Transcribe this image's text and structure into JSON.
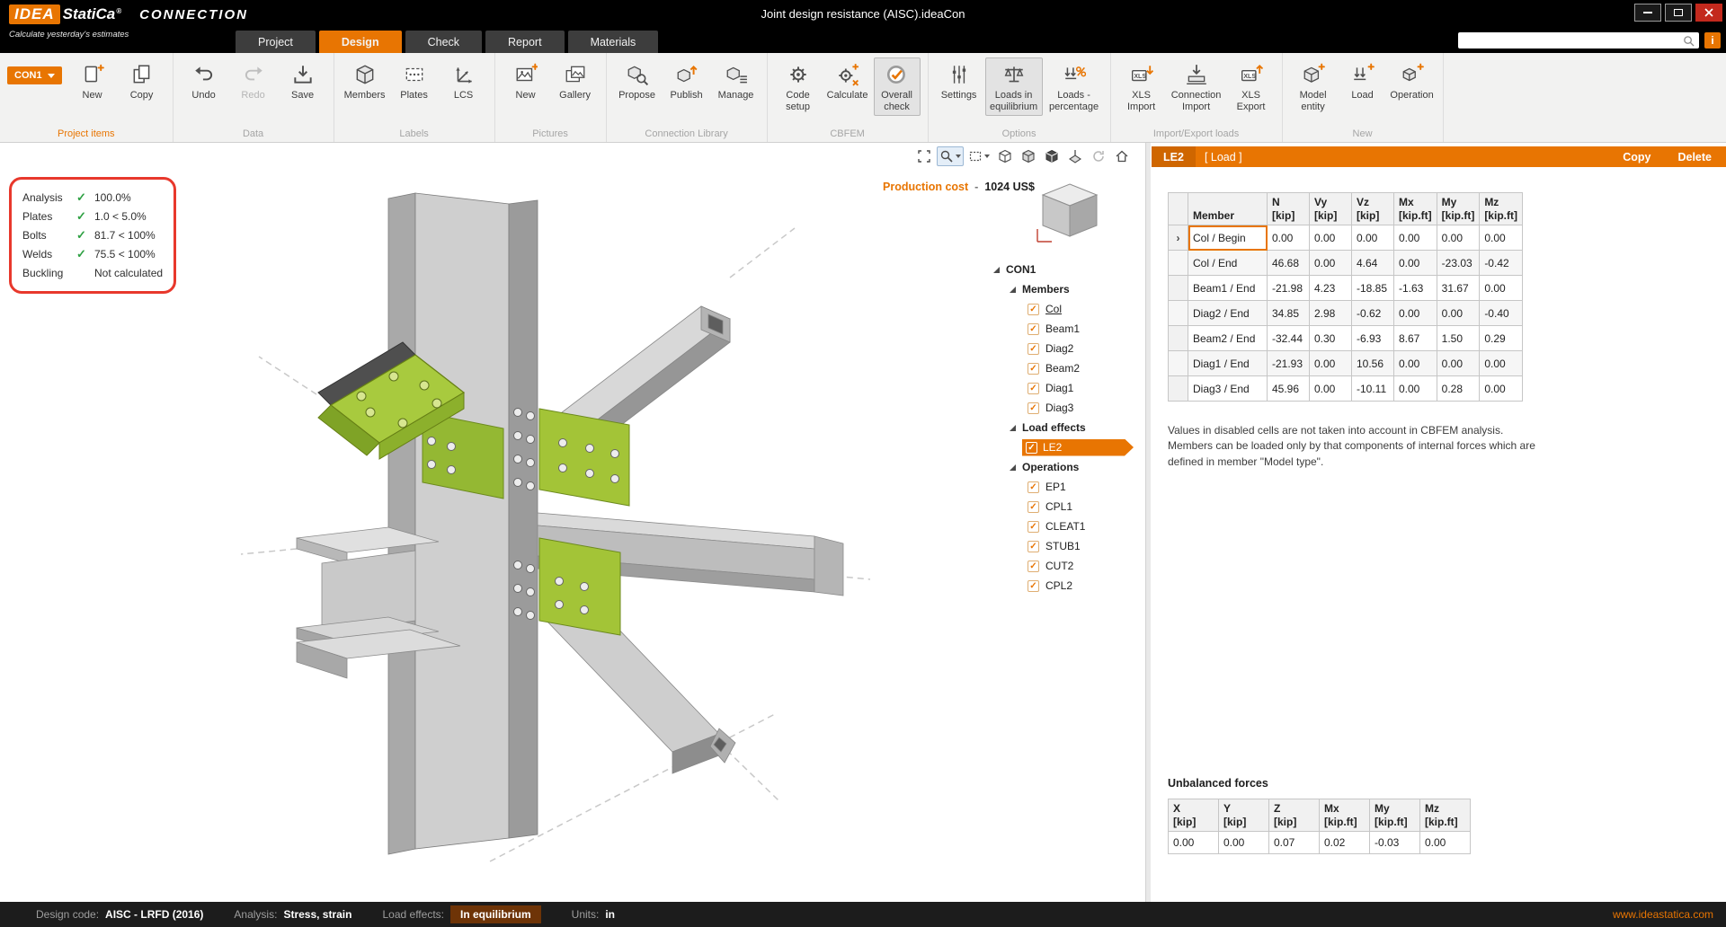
{
  "icons": {
    "check": "✓",
    "info": "i",
    "selector": "›",
    "xls": "XLS",
    "reg": "®"
  },
  "titlebar": {
    "logo": {
      "idea": "IDEA",
      "statica": "StatiCa",
      "product": "CONNECTION",
      "tagline": "Calculate yesterday's estimates"
    },
    "window_title": "Joint design resistance (AISC).ideaCon"
  },
  "tabs": {
    "items": [
      {
        "label": "Project"
      },
      {
        "label": "Design"
      },
      {
        "label": "Check"
      },
      {
        "label": "Report"
      },
      {
        "label": "Materials"
      }
    ]
  },
  "ribbon": {
    "project_items": {
      "label": "Project items",
      "con1": "CON1",
      "new": "New",
      "copy": "Copy"
    },
    "data": {
      "label": "Data",
      "undo": "Undo",
      "redo": "Redo",
      "save": "Save"
    },
    "labels": {
      "label": "Labels",
      "members": "Members",
      "plates": "Plates",
      "lcs": "LCS"
    },
    "pictures": {
      "label": "Pictures",
      "new": "New",
      "gallery": "Gallery"
    },
    "library": {
      "label": "Connection Library",
      "propose": "Propose",
      "publish": "Publish",
      "manage": "Manage"
    },
    "cbfem": {
      "label": "CBFEM",
      "code_setup": "Code setup",
      "calculate": "Calculate",
      "overall_check": "Overall check"
    },
    "options": {
      "label": "Options",
      "settings": "Settings",
      "loads_eq": "Loads in equilibrium",
      "loads_pct": "Loads - percentage"
    },
    "import_export": {
      "label": "Import/Export loads",
      "xls_import": "XLS Import",
      "conn_import": "Connection Import",
      "xls_export": "XLS Export"
    },
    "new_group": {
      "label": "New",
      "model_entity": "Model entity",
      "load": "Load",
      "operation": "Operation"
    }
  },
  "viewport": {
    "summary": {
      "rows": [
        {
          "label": "Analysis",
          "check": "✓",
          "value": "100.0%"
        },
        {
          "label": "Plates",
          "check": "✓",
          "value": "1.0 < 5.0%"
        },
        {
          "label": "Bolts",
          "check": "✓",
          "value": "81.7 < 100%"
        },
        {
          "label": "Welds",
          "check": "✓",
          "value": "75.5 < 100%"
        },
        {
          "label": "Buckling",
          "check": "",
          "value": "Not calculated"
        }
      ]
    },
    "production_cost": {
      "label": "Production cost",
      "sep": "-",
      "value": "1024 US$"
    }
  },
  "tree": {
    "root": "CON1",
    "members_label": "Members",
    "members": [
      "Col",
      "Beam1",
      "Diag2",
      "Beam2",
      "Diag1",
      "Diag3"
    ],
    "load_effects_label": "Load effects",
    "load_effects": [
      "LE2"
    ],
    "operations_label": "Operations",
    "operations": [
      "EP1",
      "CPL1",
      "CLEAT1",
      "STUB1",
      "CUT2",
      "CPL2"
    ]
  },
  "panel": {
    "title": "LE2",
    "subtitle": "[ Load ]",
    "copy": "Copy",
    "delete": "Delete",
    "load_table": {
      "headers": [
        {
          "name": "Member",
          "unit": ""
        },
        {
          "name": "N",
          "unit": "[kip]"
        },
        {
          "name": "Vy",
          "unit": "[kip]"
        },
        {
          "name": "Vz",
          "unit": "[kip]"
        },
        {
          "name": "Mx",
          "unit": "[kip.ft]"
        },
        {
          "name": "My",
          "unit": "[kip.ft]"
        },
        {
          "name": "Mz",
          "unit": "[kip.ft]"
        }
      ],
      "rows": [
        {
          "member": "Col / Begin",
          "values": [
            "0.00",
            "0.00",
            "0.00",
            "0.00",
            "0.00",
            "0.00"
          ]
        },
        {
          "member": "Col / End",
          "values": [
            "46.68",
            "0.00",
            "4.64",
            "0.00",
            "-23.03",
            "-0.42"
          ]
        },
        {
          "member": "Beam1 / End",
          "values": [
            "-21.98",
            "4.23",
            "-18.85",
            "-1.63",
            "31.67",
            "0.00"
          ]
        },
        {
          "member": "Diag2 / End",
          "values": [
            "34.85",
            "2.98",
            "-0.62",
            "0.00",
            "0.00",
            "-0.40"
          ]
        },
        {
          "member": "Beam2 / End",
          "values": [
            "-32.44",
            "0.30",
            "-6.93",
            "8.67",
            "1.50",
            "0.29"
          ]
        },
        {
          "member": "Diag1 / End",
          "values": [
            "-21.93",
            "0.00",
            "10.56",
            "0.00",
            "0.00",
            "0.00"
          ]
        },
        {
          "member": "Diag3 / End",
          "values": [
            "45.96",
            "0.00",
            "-10.11",
            "0.00",
            "0.28",
            "0.00"
          ]
        }
      ]
    },
    "note": "Values in disabled cells are not taken into account in CBFEM analysis. Members can be loaded only by that components of internal forces which are defined in member \"Model type\".",
    "unbalanced": {
      "title": "Unbalanced forces",
      "headers": [
        {
          "name": "X",
          "unit": "[kip]"
        },
        {
          "name": "Y",
          "unit": "[kip]"
        },
        {
          "name": "Z",
          "unit": "[kip]"
        },
        {
          "name": "Mx",
          "unit": "[kip.ft]"
        },
        {
          "name": "My",
          "unit": "[kip.ft]"
        },
        {
          "name": "Mz",
          "unit": "[kip.ft]"
        }
      ],
      "values": [
        "0.00",
        "0.00",
        "0.07",
        "0.02",
        "-0.03",
        "0.00"
      ]
    }
  },
  "statusbar": {
    "design_code_label": "Design code:",
    "design_code": "AISC - LRFD (2016)",
    "analysis_label": "Analysis:",
    "analysis": "Stress, strain",
    "load_effects_label": "Load effects:",
    "load_effects": "In equilibrium",
    "units_label": "Units:",
    "units": "in",
    "website": "www.ideastatica.com"
  },
  "colors": {
    "accent": "#e87502",
    "ok_green": "#2ea043",
    "model_green": "#a3c437",
    "alert_red": "#e8382c"
  }
}
